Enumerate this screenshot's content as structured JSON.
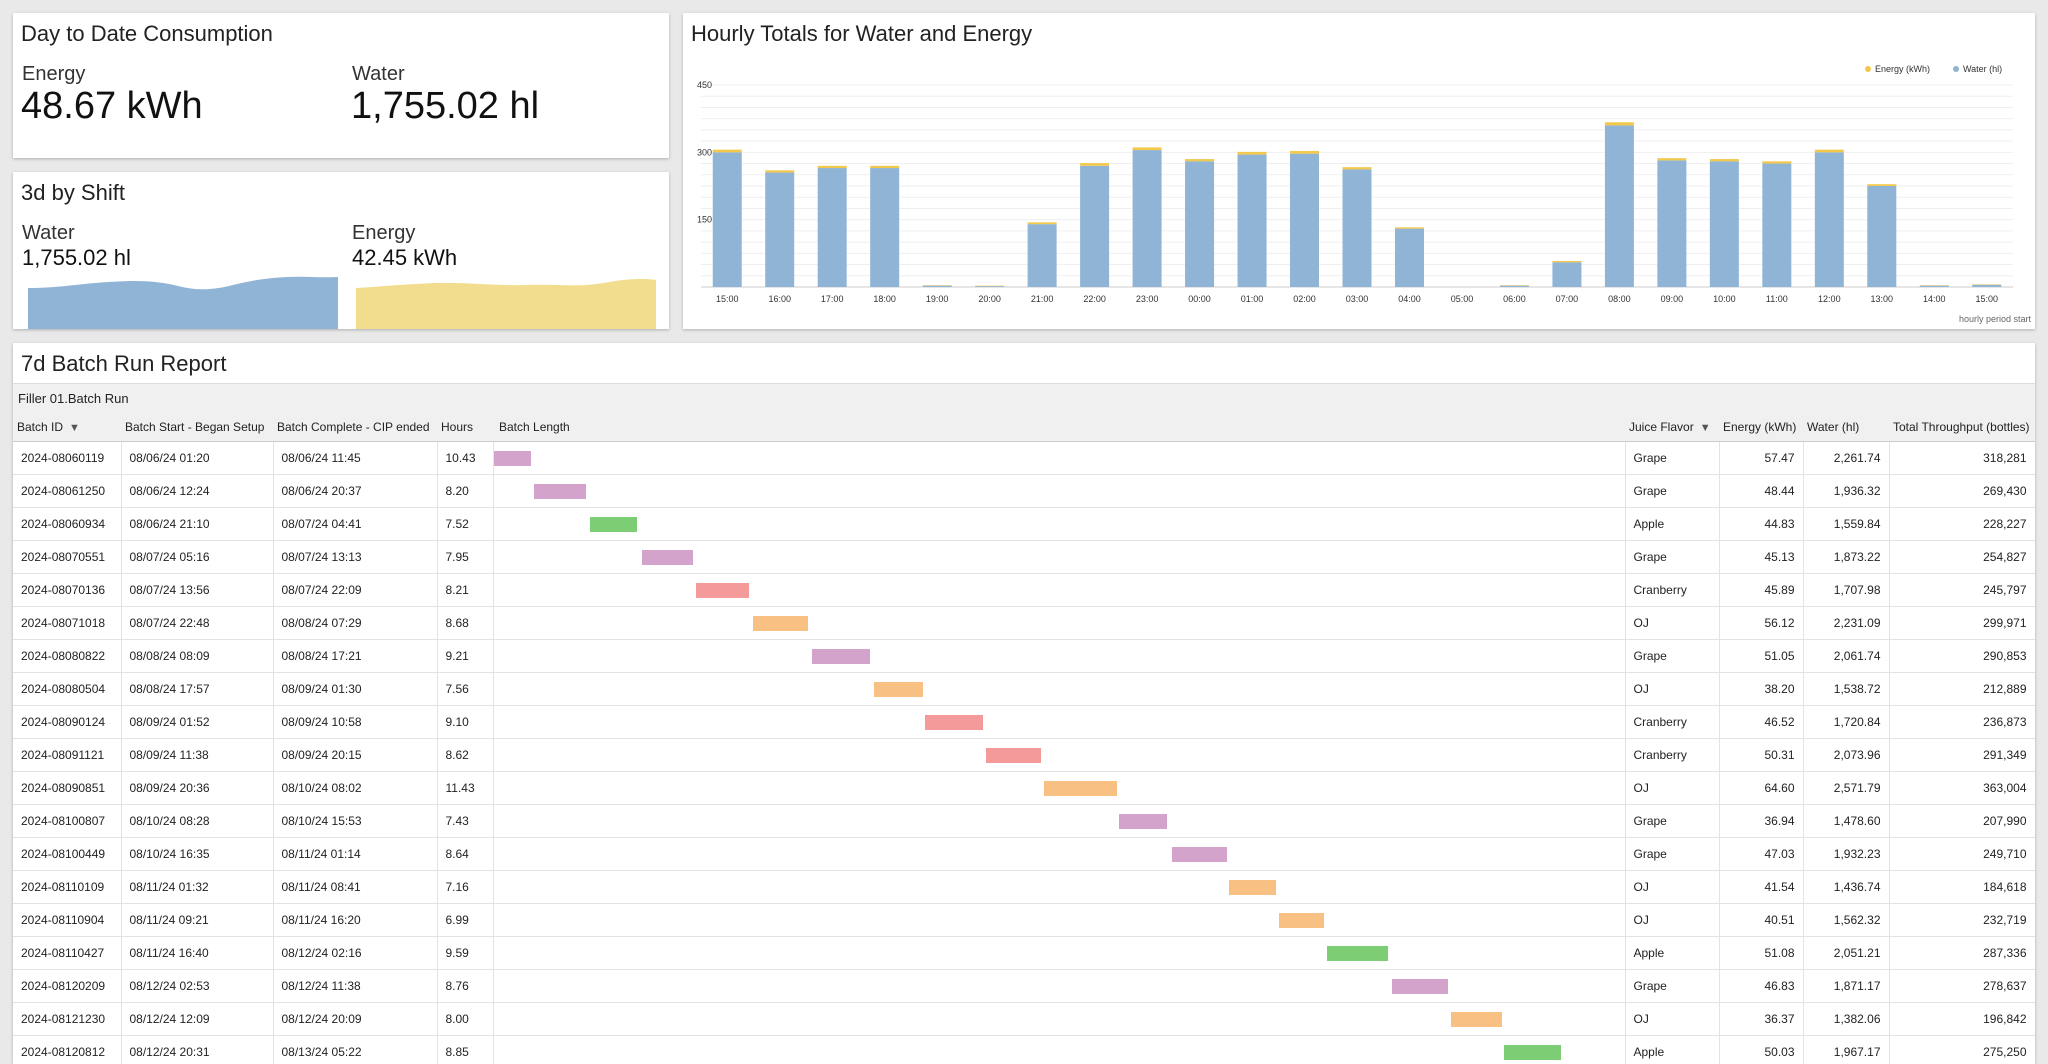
{
  "consumption": {
    "title": "Day to Date Consumption",
    "energy_label": "Energy",
    "energy_value": "48.67 kWh",
    "water_label": "Water",
    "water_value": "1,755.02 hl"
  },
  "shift": {
    "title": "3d by Shift",
    "water_label": "Water",
    "water_value": "1,755.02 hl",
    "energy_label": "Energy",
    "energy_value": "42.45 kWh",
    "water_color": "#8fb4d6",
    "energy_color": "#f2dd8e"
  },
  "hourly": {
    "title": "Hourly Totals for Water and Energy",
    "footer": "hourly period start",
    "chart_data": {
      "type": "bar",
      "stacked": true,
      "categories": [
        "15:00",
        "16:00",
        "17:00",
        "18:00",
        "19:00",
        "20:00",
        "21:00",
        "22:00",
        "23:00",
        "00:00",
        "01:00",
        "02:00",
        "03:00",
        "04:00",
        "05:00",
        "06:00",
        "07:00",
        "08:00",
        "09:00",
        "10:00",
        "11:00",
        "12:00",
        "13:00",
        "14:00",
        "15:00"
      ],
      "series": [
        {
          "name": "Water (hl)",
          "color": "#8fb4d6",
          "values": [
            300,
            255,
            265,
            265,
            3,
            2,
            140,
            270,
            305,
            280,
            295,
            297,
            262,
            130,
            0,
            3,
            55,
            360,
            282,
            280,
            275,
            300,
            225,
            3,
            5
          ]
        },
        {
          "name": "Energy (kWh)",
          "color": "#f2c94c",
          "values": [
            6,
            5,
            5,
            5,
            1,
            1,
            4,
            6,
            6,
            5,
            6,
            6,
            5,
            3,
            0,
            1,
            3,
            7,
            5,
            5,
            5,
            6,
            4,
            1,
            1
          ]
        }
      ],
      "yticks": [
        "450",
        "300",
        "150"
      ],
      "ylim": [
        0,
        450
      ],
      "grid": true,
      "legend_position": "top-right"
    }
  },
  "batch": {
    "title": "7d Batch Run Report",
    "subheader": "Filler 01.Batch Run",
    "columns": [
      "Batch ID",
      "Batch Start - Began Setup",
      "Batch Complete - CIP ended",
      "Hours",
      "Batch Length",
      "Juice Flavor",
      "Energy (kWh)",
      "Water (hl)",
      "Total Throughput (bottles)"
    ],
    "flavor_colors": {
      "Grape": "#d4a3cb",
      "Apple": "#7ccd73",
      "Cranberry": "#f49a9a",
      "OJ": "#f8c083"
    },
    "rows": [
      {
        "id": "2024-08060119",
        "start": "08/06/24 01:20",
        "end": "08/06/24 11:45",
        "hours": "10.43",
        "flavor": "Grape",
        "energy": "57.47",
        "water": "2,261.74",
        "throughput": "318,281",
        "bar_from": 0.0,
        "bar_to": 0.033
      },
      {
        "id": "2024-08061250",
        "start": "08/06/24 12:24",
        "end": "08/06/24 20:37",
        "hours": "8.20",
        "flavor": "Grape",
        "energy": "48.44",
        "water": "1,936.32",
        "throughput": "269,430",
        "bar_from": 0.036,
        "bar_to": 0.082
      },
      {
        "id": "2024-08060934",
        "start": "08/06/24 21:10",
        "end": "08/07/24 04:41",
        "hours": "7.52",
        "flavor": "Apple",
        "energy": "44.83",
        "water": "1,559.84",
        "throughput": "228,227",
        "bar_from": 0.085,
        "bar_to": 0.127
      },
      {
        "id": "2024-08070551",
        "start": "08/07/24 05:16",
        "end": "08/07/24 13:13",
        "hours": "7.95",
        "flavor": "Grape",
        "energy": "45.13",
        "water": "1,873.22",
        "throughput": "254,827",
        "bar_from": 0.131,
        "bar_to": 0.176
      },
      {
        "id": "2024-08070136",
        "start": "08/07/24 13:56",
        "end": "08/07/24 22:09",
        "hours": "8.21",
        "flavor": "Cranberry",
        "energy": "45.89",
        "water": "1,707.98",
        "throughput": "245,797",
        "bar_from": 0.179,
        "bar_to": 0.226
      },
      {
        "id": "2024-08071018",
        "start": "08/07/24 22:48",
        "end": "08/08/24 07:29",
        "hours": "8.68",
        "flavor": "OJ",
        "energy": "56.12",
        "water": "2,231.09",
        "throughput": "299,971",
        "bar_from": 0.229,
        "bar_to": 0.278
      },
      {
        "id": "2024-08080822",
        "start": "08/08/24 08:09",
        "end": "08/08/24 17:21",
        "hours": "9.21",
        "flavor": "Grape",
        "energy": "51.05",
        "water": "2,061.74",
        "throughput": "290,853",
        "bar_from": 0.281,
        "bar_to": 0.333
      },
      {
        "id": "2024-08080504",
        "start": "08/08/24 17:57",
        "end": "08/09/24 01:30",
        "hours": "7.56",
        "flavor": "OJ",
        "energy": "38.20",
        "water": "1,538.72",
        "throughput": "212,889",
        "bar_from": 0.336,
        "bar_to": 0.379
      },
      {
        "id": "2024-08090124",
        "start": "08/09/24 01:52",
        "end": "08/09/24 10:58",
        "hours": "9.10",
        "flavor": "Cranberry",
        "energy": "46.52",
        "water": "1,720.84",
        "throughput": "236,873",
        "bar_from": 0.381,
        "bar_to": 0.432
      },
      {
        "id": "2024-08091121",
        "start": "08/09/24 11:38",
        "end": "08/09/24 20:15",
        "hours": "8.62",
        "flavor": "Cranberry",
        "energy": "50.31",
        "water": "2,073.96",
        "throughput": "291,349",
        "bar_from": 0.435,
        "bar_to": 0.484
      },
      {
        "id": "2024-08090851",
        "start": "08/09/24 20:36",
        "end": "08/10/24 08:02",
        "hours": "11.43",
        "flavor": "OJ",
        "energy": "64.60",
        "water": "2,571.79",
        "throughput": "363,004",
        "bar_from": 0.486,
        "bar_to": 0.551
      },
      {
        "id": "2024-08100807",
        "start": "08/10/24 08:28",
        "end": "08/10/24 15:53",
        "hours": "7.43",
        "flavor": "Grape",
        "energy": "36.94",
        "water": "1,478.60",
        "throughput": "207,990",
        "bar_from": 0.553,
        "bar_to": 0.595
      },
      {
        "id": "2024-08100449",
        "start": "08/10/24 16:35",
        "end": "08/11/24 01:14",
        "hours": "8.64",
        "flavor": "Grape",
        "energy": "47.03",
        "water": "1,932.23",
        "throughput": "249,710",
        "bar_from": 0.599,
        "bar_to": 0.648
      },
      {
        "id": "2024-08110109",
        "start": "08/11/24 01:32",
        "end": "08/11/24 08:41",
        "hours": "7.16",
        "flavor": "OJ",
        "energy": "41.54",
        "water": "1,436.74",
        "throughput": "184,618",
        "bar_from": 0.65,
        "bar_to": 0.691
      },
      {
        "id": "2024-08110904",
        "start": "08/11/24 09:21",
        "end": "08/11/24 16:20",
        "hours": "6.99",
        "flavor": "OJ",
        "energy": "40.51",
        "water": "1,562.32",
        "throughput": "232,719",
        "bar_from": 0.694,
        "bar_to": 0.734
      },
      {
        "id": "2024-08110427",
        "start": "08/11/24 16:40",
        "end": "08/12/24 02:16",
        "hours": "9.59",
        "flavor": "Apple",
        "energy": "51.08",
        "water": "2,051.21",
        "throughput": "287,336",
        "bar_from": 0.736,
        "bar_to": 0.79
      },
      {
        "id": "2024-08120209",
        "start": "08/12/24 02:53",
        "end": "08/12/24 11:38",
        "hours": "8.76",
        "flavor": "Grape",
        "energy": "46.83",
        "water": "1,871.17",
        "throughput": "278,637",
        "bar_from": 0.794,
        "bar_to": 0.843
      },
      {
        "id": "2024-08121230",
        "start": "08/12/24 12:09",
        "end": "08/12/24 20:09",
        "hours": "8.00",
        "flavor": "OJ",
        "energy": "36.37",
        "water": "1,382.06",
        "throughput": "196,842",
        "bar_from": 0.846,
        "bar_to": 0.891
      },
      {
        "id": "2024-08120812",
        "start": "08/12/24 20:31",
        "end": "08/13/24 05:22",
        "hours": "8.85",
        "flavor": "Apple",
        "energy": "50.03",
        "water": "1,967.17",
        "throughput": "275,250",
        "bar_from": 0.893,
        "bar_to": 0.943
      }
    ]
  }
}
